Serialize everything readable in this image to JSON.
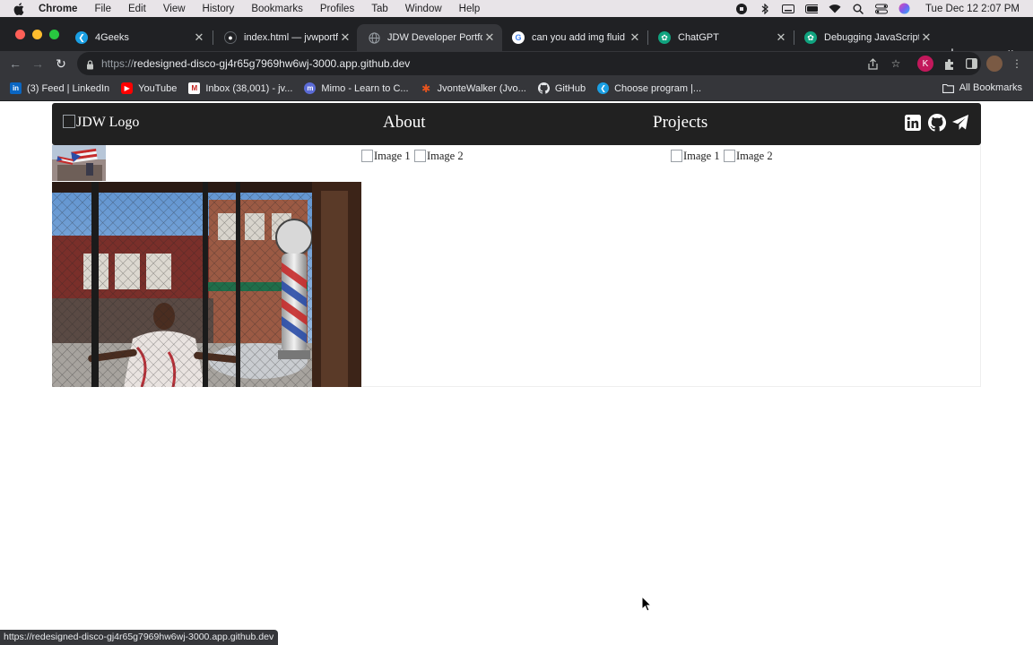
{
  "menubar": {
    "app_name": "Chrome",
    "items": [
      "File",
      "Edit",
      "View",
      "History",
      "Bookmarks",
      "Profiles",
      "Tab",
      "Window",
      "Help"
    ],
    "clock": "Tue Dec 12  2:07 PM"
  },
  "tabs": [
    {
      "label": "4Geeks",
      "favicon": "4geeks-icon",
      "color": "#1a9fe3"
    },
    {
      "label": "index.html — jvwportfolio",
      "favicon": "github-icon",
      "color": "#e8eaed"
    },
    {
      "label": "JDW Developer Portfolio",
      "favicon": "globe-icon",
      "color": "#9aa0a6",
      "active": true
    },
    {
      "label": "can you add img fluid to",
      "favicon": "google-icon",
      "color": "#4285f4"
    },
    {
      "label": "ChatGPT",
      "favicon": "chatgpt-icon",
      "color": "#10a37f"
    },
    {
      "label": "Debugging JavaScript",
      "favicon": "chatgpt-icon",
      "color": "#10a37f"
    }
  ],
  "omnibox": {
    "scheme": "https://",
    "host": "redesigned-disco-gj4r65g7969hw6wj-3000.app.github.dev",
    "profile_initial": "K"
  },
  "bookmarks": [
    {
      "label": "(3) Feed | LinkedIn",
      "icon": "linkedin-icon",
      "color": "#0a66c2",
      "glyph": "in"
    },
    {
      "label": "YouTube",
      "icon": "youtube-icon",
      "color": "#ff0000",
      "glyph": "▶"
    },
    {
      "label": "Inbox (38,001) - jv...",
      "icon": "gmail-icon",
      "color": "#c5221f",
      "glyph": "M"
    },
    {
      "label": "Mimo - Learn to C...",
      "icon": "mimo-icon",
      "color": "#5b6bd6",
      "glyph": "m"
    },
    {
      "label": "JvonteWalker (Jvo...",
      "icon": "codecademy-icon",
      "color": "#e8541e",
      "glyph": "✱"
    },
    {
      "label": "GitHub",
      "icon": "github-icon",
      "color": "#202124",
      "glyph": "●"
    },
    {
      "label": "Choose program |...",
      "icon": "4geeks-icon",
      "color": "#1a9fe3",
      "glyph": "❮"
    }
  ],
  "all_bookmarks": "All Bookmarks",
  "site": {
    "logo_alt": "JDW Logo",
    "nav": [
      "About",
      "Projects"
    ],
    "image_alts": {
      "col2_img1": "Image 1",
      "col2_img2": "Image 2",
      "col3_img1": "Image 1",
      "col3_img2": "Image 2"
    }
  },
  "status_url": "https://redesigned-disco-gj4r65g7969hw6wj-3000.app.github.dev",
  "colors": {
    "chrome_dark": "#202124",
    "chrome_toolbar": "#35363a",
    "site_nav_bg": "#212121"
  }
}
